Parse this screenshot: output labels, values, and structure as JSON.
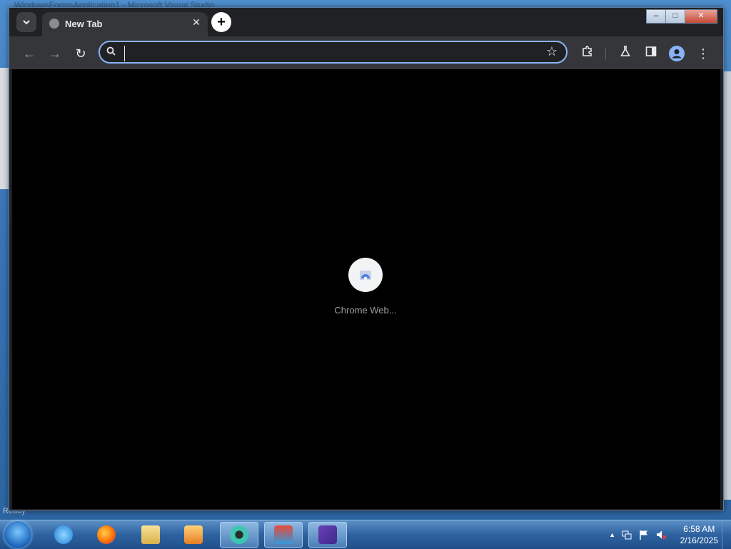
{
  "background_window": {
    "title": "WindowsFormsApplication1 - Microsoft Visual Studio",
    "status": "Ready"
  },
  "browser": {
    "tab": {
      "title": "New Tab"
    },
    "tab_close_glyph": "✕",
    "new_tab_glyph": "+",
    "window_controls": {
      "minimize": "–",
      "maximize": "□",
      "close": "✕"
    },
    "toolbar": {
      "back_glyph": "←",
      "forward_glyph": "→",
      "reload_glyph": "↻",
      "omnibox_value": "",
      "star_glyph": "☆",
      "menu_glyph": "⋮"
    },
    "new_tab_page": {
      "shortcuts": [
        {
          "label": "Chrome Web..."
        }
      ]
    }
  },
  "taskbar": {
    "clock": {
      "time": "6:58 AM",
      "date": "2/16/2025"
    },
    "tray_arrow": "▲"
  },
  "colors": {
    "omnibox_border": "#8ab4f8",
    "page_background": "#000000",
    "toolbar": "#35363a"
  },
  "icons": {
    "tab_search": "chevron-down-icon",
    "favicon": "globe-icon",
    "star": "star-icon",
    "extensions": "puzzle-icon",
    "labs": "flask-icon",
    "side_panel": "side-panel-icon",
    "profile": "profile-icon",
    "menu": "kebab-menu-icon"
  }
}
